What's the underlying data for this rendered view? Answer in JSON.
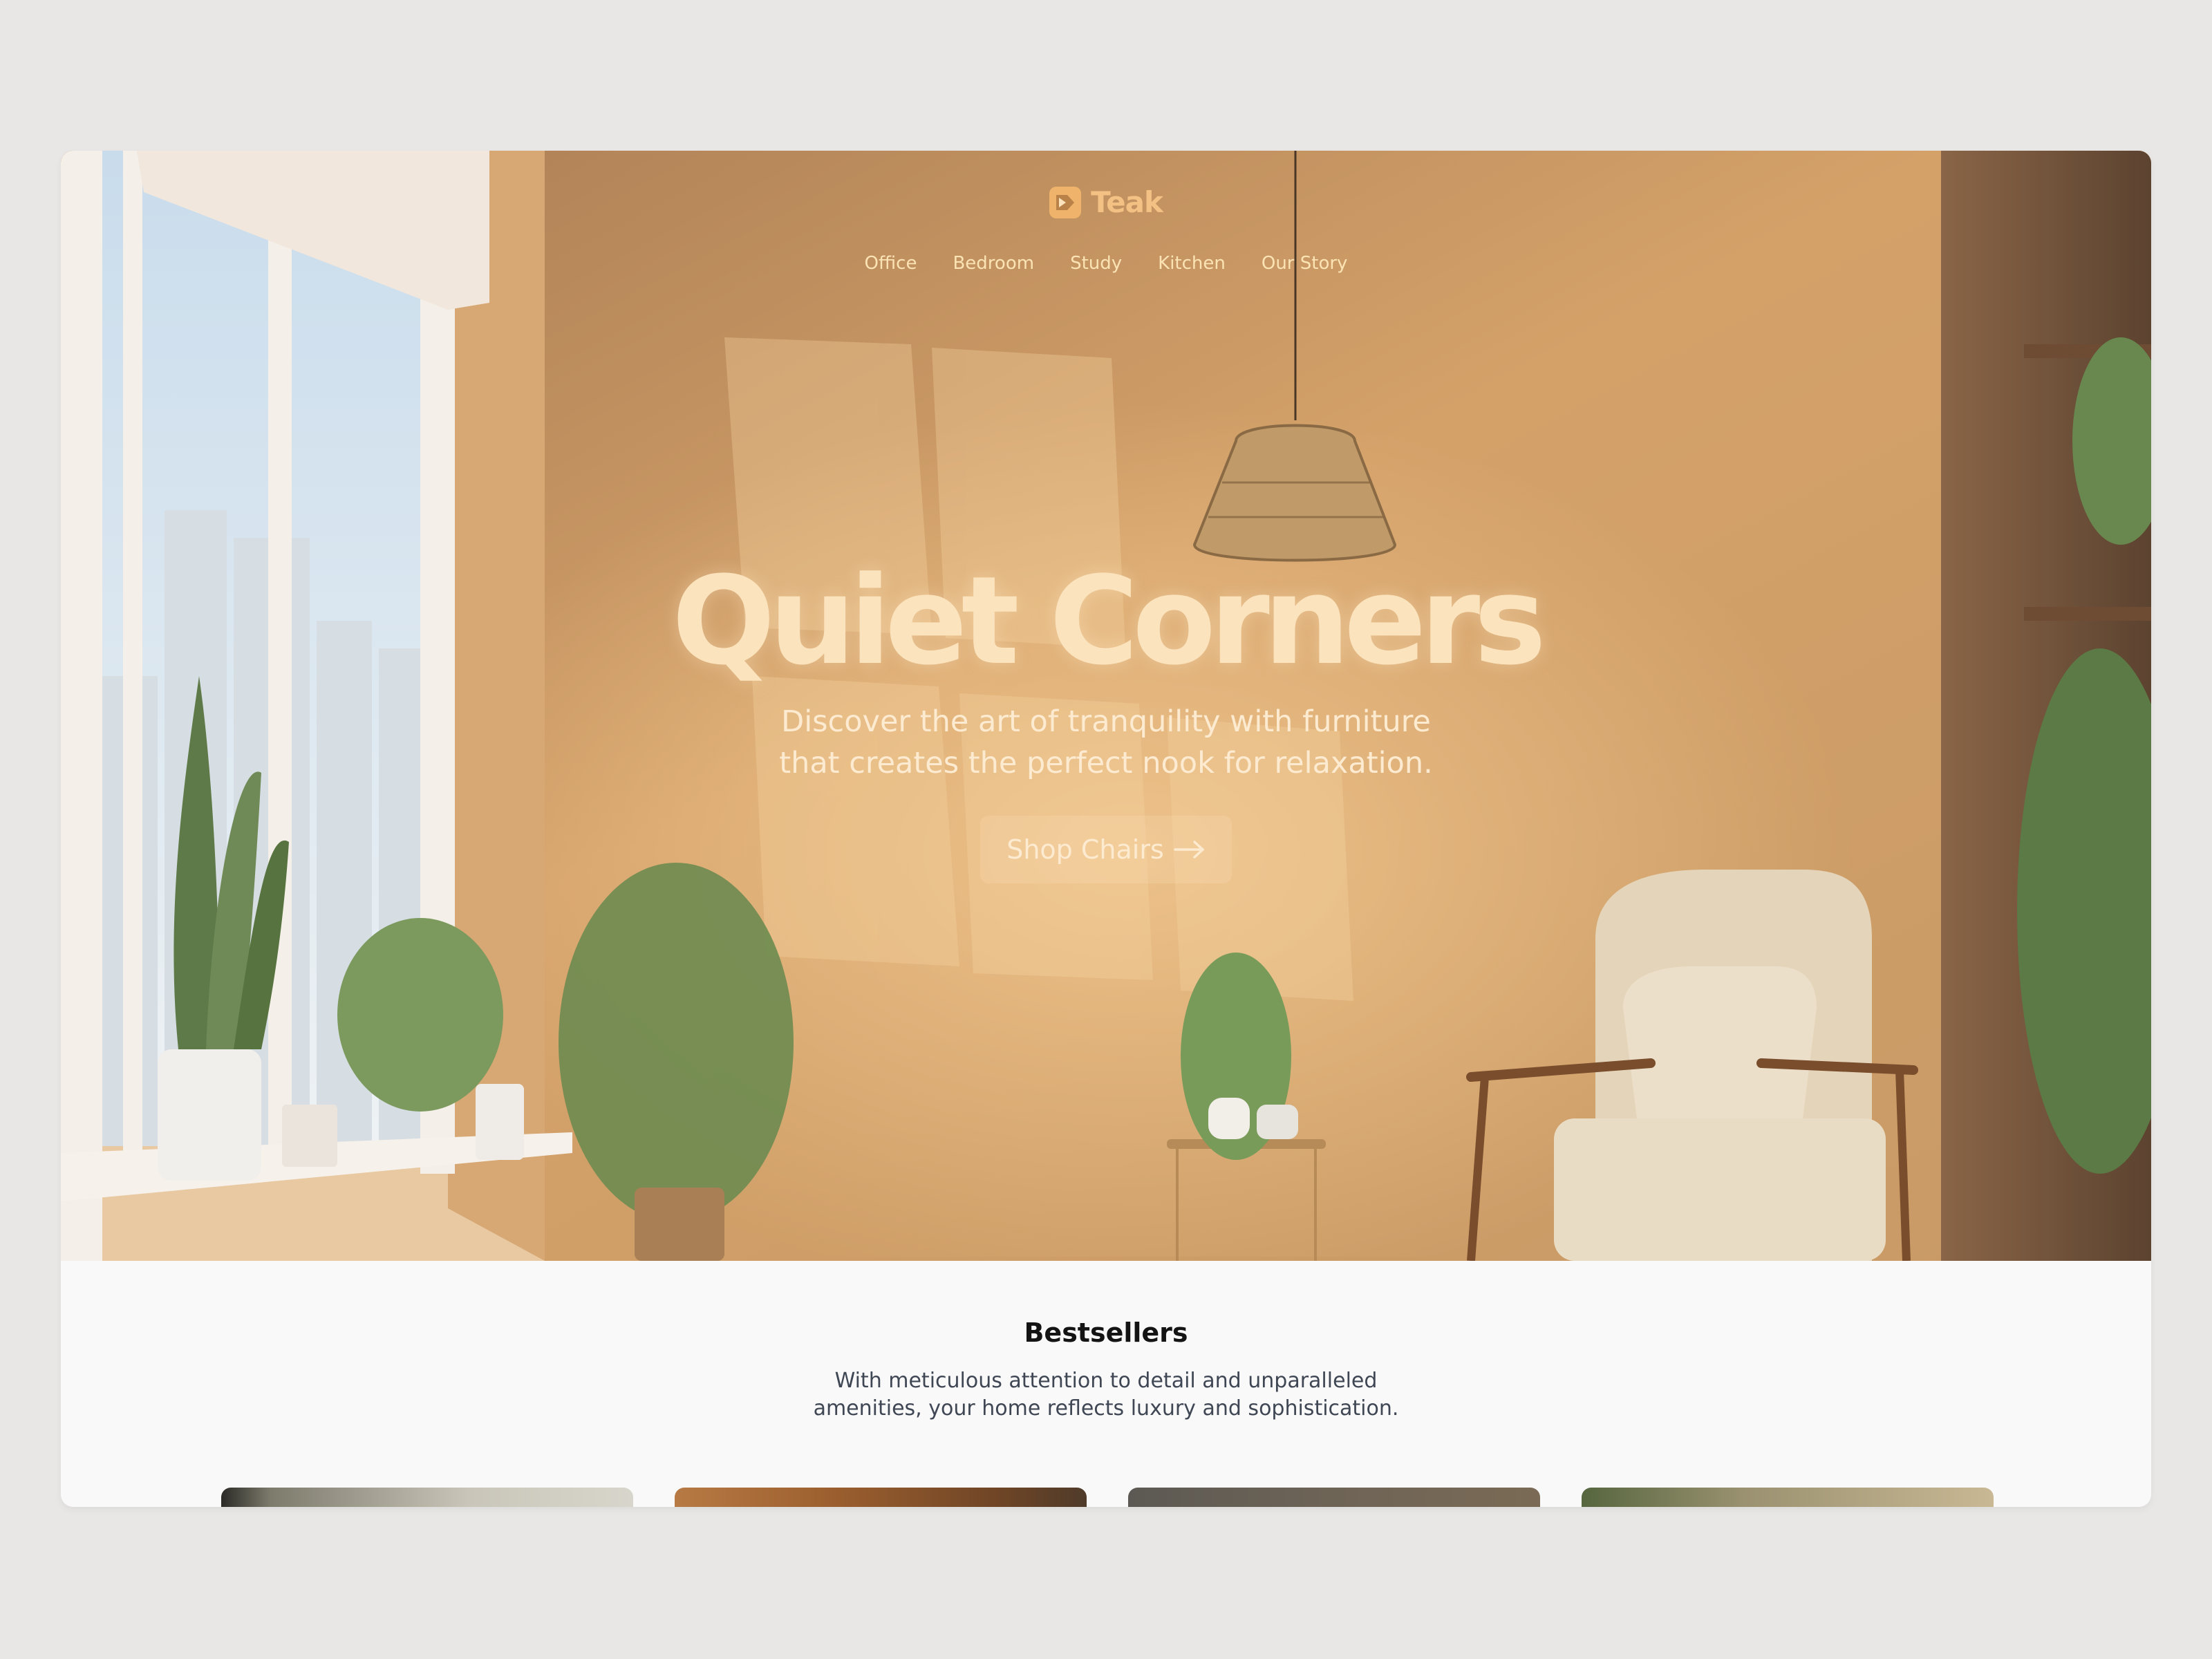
{
  "brand": {
    "name": "Teak",
    "accent": "#efb36c"
  },
  "nav": {
    "items": [
      "Office",
      "Bedroom",
      "Study",
      "Kitchen",
      "Our Story"
    ]
  },
  "hero": {
    "title": "Quiet Corners",
    "subtitle_line1": "Discover the art of tranquility with furniture",
    "subtitle_line2": "that creates the perfect nook for relaxation.",
    "cta_label": "Shop Chairs",
    "cta_icon": "arrow-right-icon"
  },
  "bestsellers": {
    "title": "Bestsellers",
    "description_line1": "With meticulous attention to detail and unparalleled",
    "description_line2": "amenities, your home reflects luxury and sophistication."
  },
  "colors": {
    "page_background": "#e8e7e5",
    "section_background": "#f9f9f9",
    "hero_text": "#fbe3bd",
    "nav_text": "#fbe3b4"
  }
}
